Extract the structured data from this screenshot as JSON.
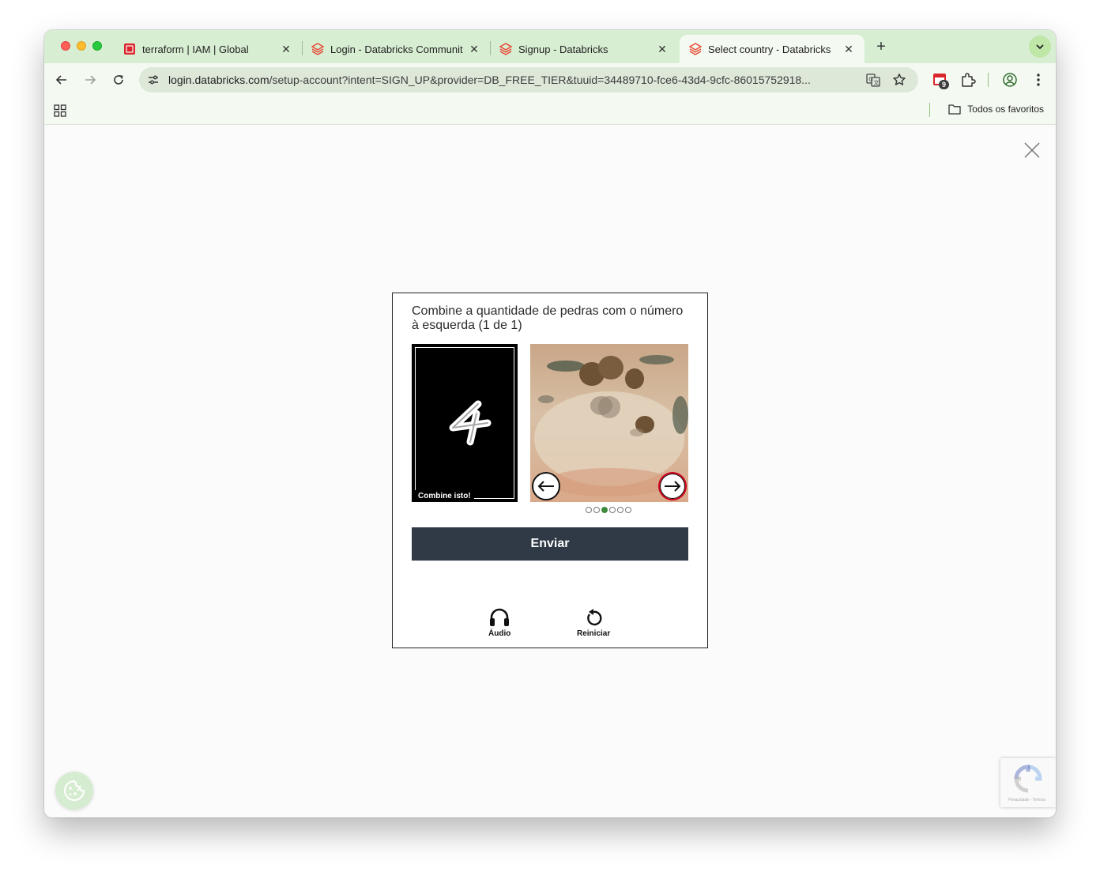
{
  "browser": {
    "tabs": [
      {
        "title": "terraform | IAM | Global",
        "favicon": "aws-console-icon",
        "active": false
      },
      {
        "title": "Login - Databricks Communit",
        "favicon": "databricks-icon",
        "active": false
      },
      {
        "title": "Signup - Databricks",
        "favicon": "databricks-icon",
        "active": false
      },
      {
        "title": "Select country - Databricks",
        "favicon": "databricks-icon",
        "active": true
      }
    ],
    "tab_close": "✕",
    "new_tab": "+",
    "address": {
      "host": "login.databricks.com",
      "path": "/setup-account?intent=SIGN_UP&provider=DB_FREE_TIER&tuuid=34489710-fce6-43d4-9cfc-86015752918..."
    },
    "extension_badge": "9",
    "bookmarks": {
      "folder_label": "Todos os favoritos"
    }
  },
  "captcha": {
    "prompt": "Combine a quantidade de pedras com o número à esquerda (1 de 1)",
    "number_card_caption": "Combine isto!",
    "number_value": "4",
    "carousel": {
      "total": 6,
      "current_index": 2
    },
    "submit_label": "Enviar",
    "audio_label": "Áudio",
    "reset_label": "Reiniciar"
  },
  "recaptcha": {
    "footer": "Privacidade - Termos"
  },
  "colors": {
    "tabstrip": "#d8eed3",
    "toolbar": "#f4faf2",
    "submit_bg": "#2f3a46",
    "dot_active": "#3f8a3f"
  }
}
